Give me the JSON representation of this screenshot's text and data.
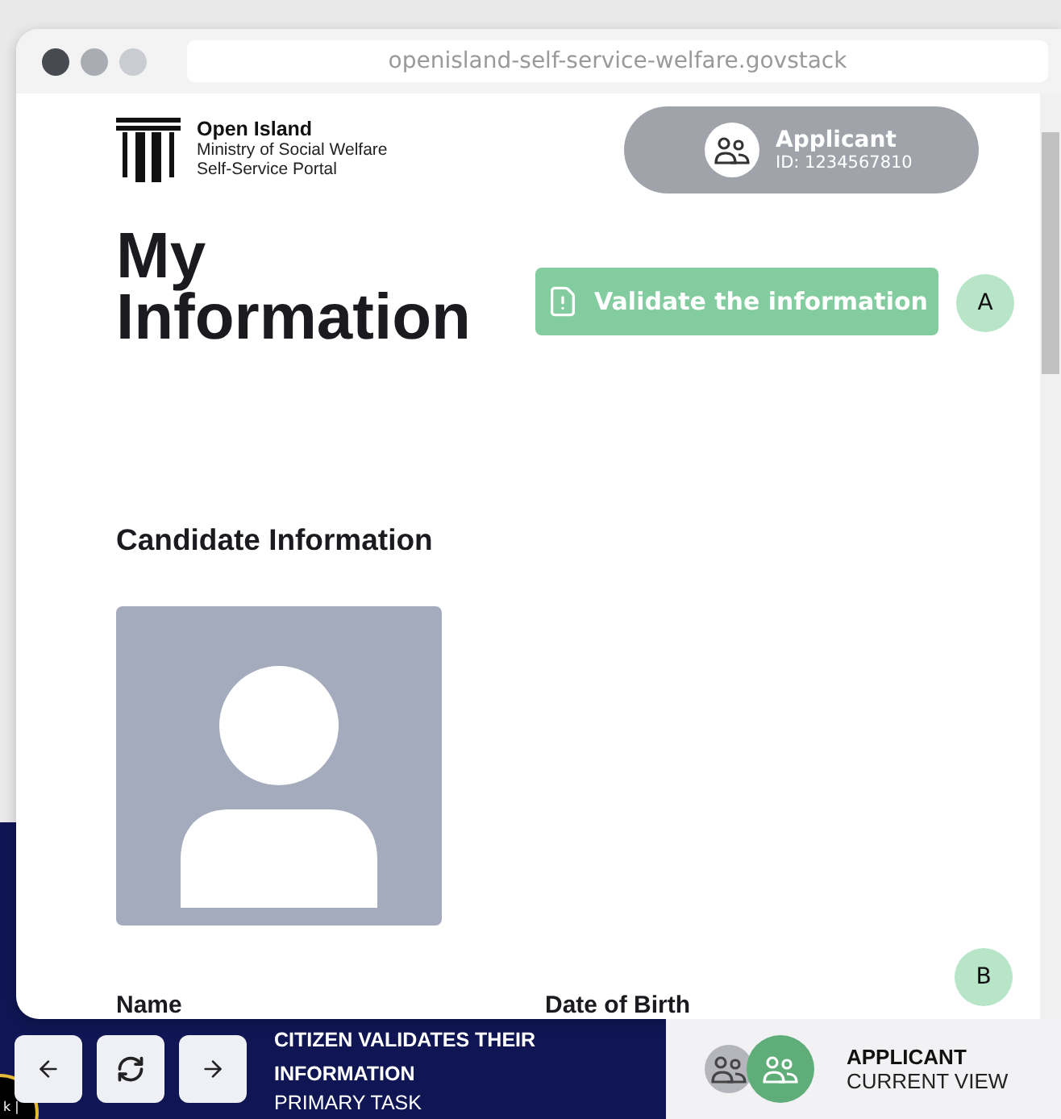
{
  "browser": {
    "address": "openisland-self-service-welfare.govstack"
  },
  "header": {
    "brand": "Open Island",
    "subtitle_lines": [
      "Ministry of Social Welfare",
      "Self-Service Portal"
    ],
    "user": {
      "role": "Applicant",
      "id": "ID: 1234567810"
    }
  },
  "page": {
    "title_lines": [
      "My",
      "Information"
    ],
    "action": {
      "label": "Validate the information"
    },
    "markers": [
      "A",
      "B"
    ],
    "section": "Candidate Information",
    "fields": [
      "Name",
      "Date of Birth"
    ]
  },
  "task_bar": {
    "badge": "k |",
    "task_lines": [
      "CITIZEN VALIDATES THEIR",
      "INFORMATION"
    ],
    "task_type": "PRIMARY TASK",
    "view": {
      "role": "APPLICANT",
      "caption": "CURRENT VIEW"
    }
  }
}
